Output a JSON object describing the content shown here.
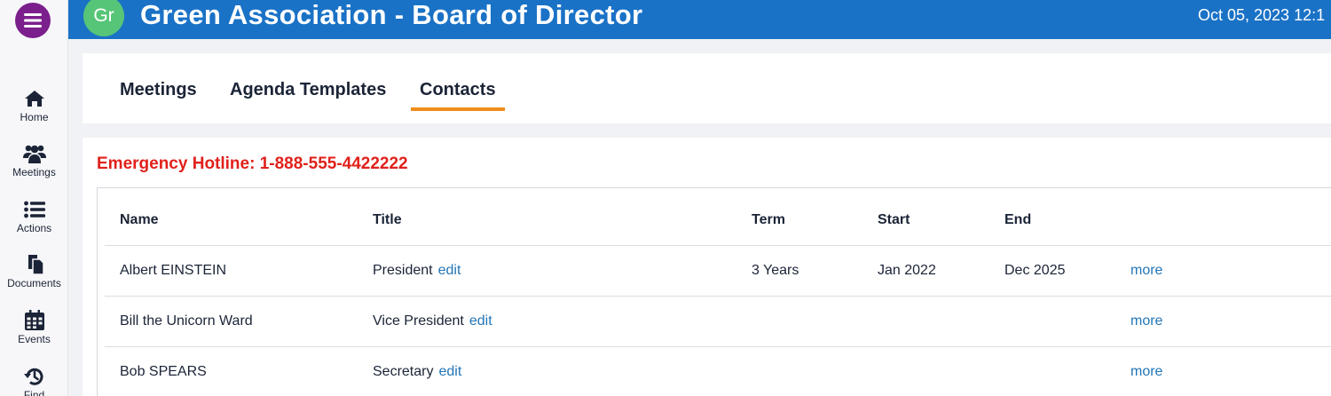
{
  "sidebar": {
    "menu_icon": "hamburger-menu-icon",
    "items": [
      {
        "label": "Home",
        "icon": "home-icon"
      },
      {
        "label": "Meetings",
        "icon": "users-icon"
      },
      {
        "label": "Actions",
        "icon": "list-icon"
      },
      {
        "label": "Documents",
        "icon": "documents-icon"
      },
      {
        "label": "Events",
        "icon": "calendar-icon"
      },
      {
        "label": "Find",
        "icon": "history-icon"
      }
    ]
  },
  "header": {
    "avatar_initials": "Gr",
    "title": "Green Association - Board of Director",
    "datetime": "Oct 05, 2023 12:1"
  },
  "tabs": [
    {
      "label": "Meetings",
      "active": false
    },
    {
      "label": "Agenda Templates",
      "active": false
    },
    {
      "label": "Contacts",
      "active": true
    }
  ],
  "contacts": {
    "hotline": "Emergency Hotline: 1-888-555-4422222",
    "columns": {
      "name": "Name",
      "title": "Title",
      "term": "Term",
      "start": "Start",
      "end": "End"
    },
    "edit_label": "edit",
    "more_label": "more",
    "rows": [
      {
        "name": "Albert EINSTEIN",
        "title": "President",
        "term": "3 Years",
        "start": "Jan 2022",
        "end": "Dec 2025"
      },
      {
        "name": "Bill the Unicorn Ward",
        "title": "Vice President",
        "term": "",
        "start": "",
        "end": ""
      },
      {
        "name": "Bob SPEARS",
        "title": "Secretary",
        "term": "",
        "start": "",
        "end": ""
      }
    ]
  },
  "colors": {
    "header_bg": "#1a72c6",
    "menu_button": "#7b1f8c",
    "avatar_bg": "#57c577",
    "active_tab_underline": "#f08c1a",
    "hotline_text": "#e0211b",
    "link": "#2275b7"
  }
}
